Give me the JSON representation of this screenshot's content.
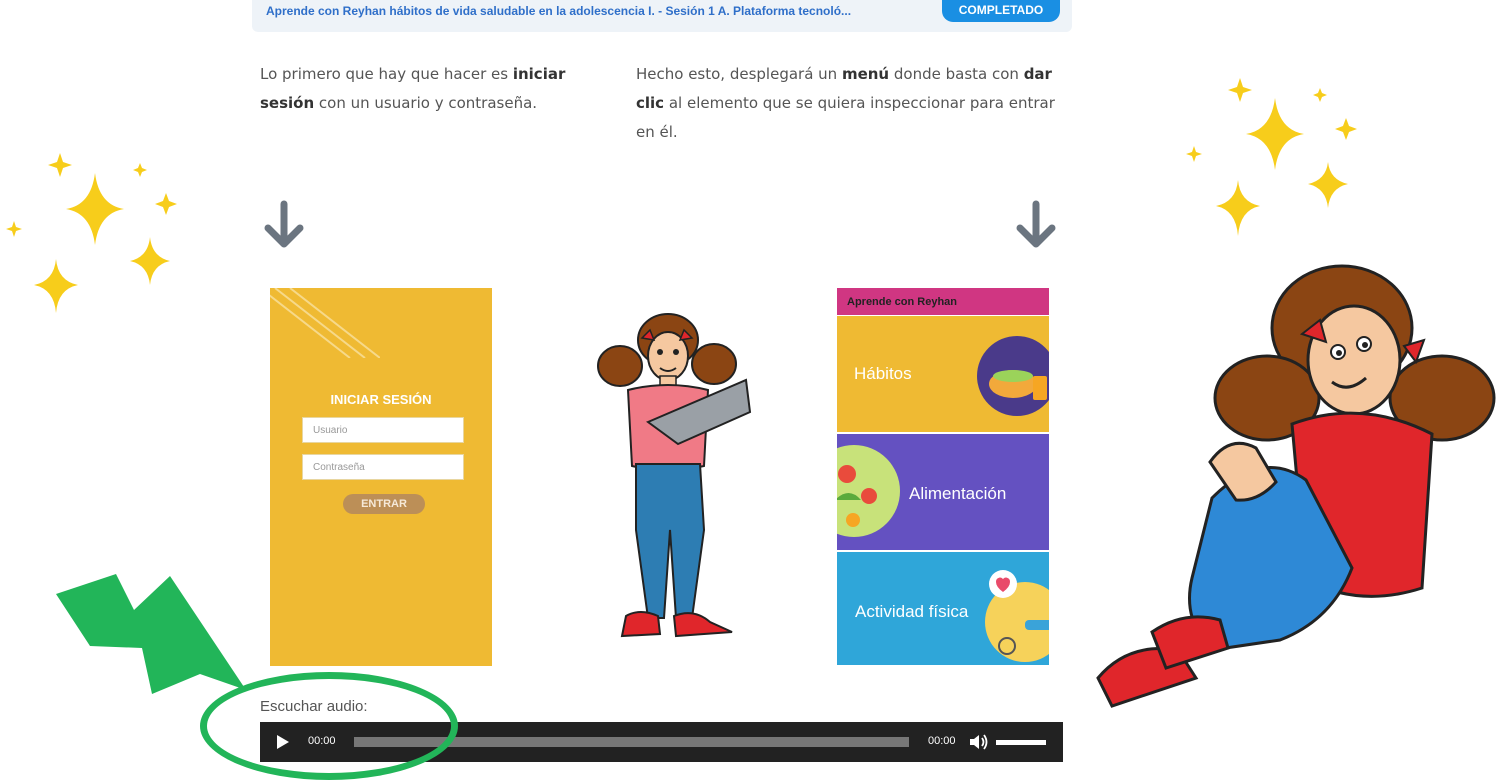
{
  "course_bar": {
    "title": "Aprende con Reyhan hábitos de vida saludable en la adolescencia I. - Sesión 1 A. Plataforma tecnoló...",
    "badge": "COMPLETADO"
  },
  "instructions": {
    "left": {
      "before": "Lo primero que hay que hacer es ",
      "bold": "iniciar sesión",
      "after": " con un usuario y contraseña."
    },
    "right": {
      "before": "Hecho esto, desplegará un ",
      "bold1": "menú",
      "middle": " donde basta con ",
      "bold2": "dar clic",
      "after": " al elemento que se quiera inspeccionar para entrar en él."
    }
  },
  "login_screen": {
    "title": "INICIAR SESIÓN",
    "user_placeholder": "Usuario",
    "password_placeholder": "Contraseña",
    "submit_label": "ENTRAR",
    "background_color": "#efba33"
  },
  "menu_screen": {
    "header": "Aprende con Reyhan",
    "tiles": [
      {
        "label": "Hábitos",
        "color": "#efba33"
      },
      {
        "label": "Alimentación",
        "color": "#6451c1"
      },
      {
        "label": "Actividad física",
        "color": "#2fa6d9"
      }
    ]
  },
  "audio": {
    "label": "Escuchar audio:",
    "current_time": "00:00",
    "duration": "00:00",
    "progress_percent": 0,
    "volume_percent": 100
  },
  "accent_colors": {
    "highlight_green": "#22b559",
    "sparkle_yellow": "#f7cd1b",
    "arrow_gray": "#6b7580"
  }
}
